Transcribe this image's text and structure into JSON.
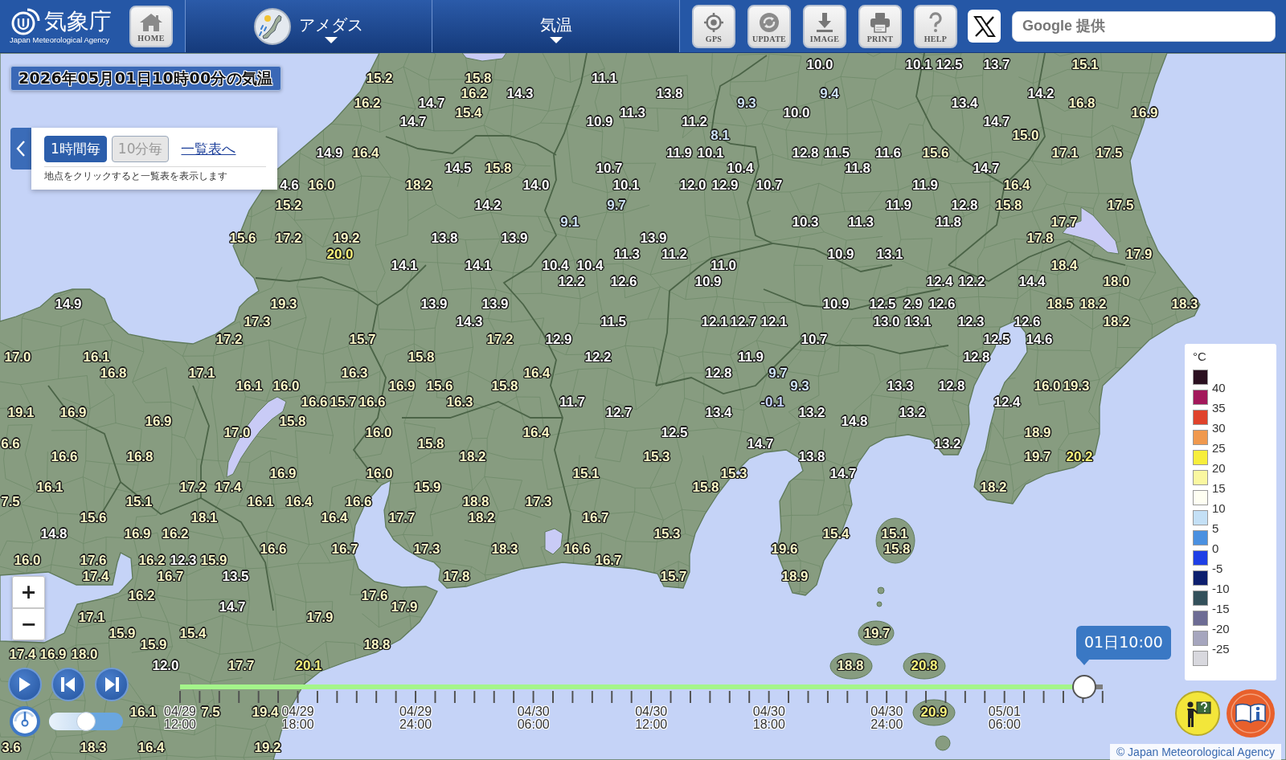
{
  "header": {
    "agency_name": "気象庁",
    "agency_subtitle": "Japan Meteorological Agency",
    "home_button": "HOME",
    "menus": [
      {
        "label": "アメダス",
        "kind": "amedas"
      },
      {
        "label": "気温",
        "kind": "element"
      }
    ],
    "tool_buttons": [
      {
        "label": "GPS",
        "kind": "locate"
      },
      {
        "label": "UPDATE",
        "kind": "refresh"
      },
      {
        "label": "IMAGE",
        "kind": "download"
      },
      {
        "label": "PRINT",
        "kind": "print"
      },
      {
        "label": "HELP",
        "kind": "help"
      }
    ],
    "search": {
      "placeholder": "Google 提供"
    }
  },
  "map_title": "2026年05月01日10時00分の気温",
  "interval_panel": {
    "options": [
      {
        "label": "1時間毎",
        "selected": true
      },
      {
        "label": "10分毎",
        "selected": false
      }
    ],
    "list_link": "一覧表へ",
    "hint": "地点をクリックすると一覧表を表示します"
  },
  "zoom_controls": [
    "+",
    "−"
  ],
  "stations": [
    {
      "value": "10.0",
      "color": "#ffffff"
    },
    {
      "value": "10.1",
      "color": "#ffffff"
    },
    {
      "value": "12.5",
      "color": "#ffffff"
    },
    {
      "value": "13.7",
      "color": "#ffffff"
    },
    {
      "value": "15.1",
      "color": "#fcf8c6"
    },
    {
      "value": "15.2",
      "color": "#fcf8c6"
    },
    {
      "value": "15.8",
      "color": "#fcf8c6"
    },
    {
      "value": "11.1",
      "color": "#ffffff"
    },
    {
      "value": "16.2",
      "color": "#fcf8c6"
    },
    {
      "value": "14.3",
      "color": "#ffffff"
    },
    {
      "value": "13.8",
      "color": "#ffffff"
    },
    {
      "value": "9.4",
      "color": "#cfe3f7"
    },
    {
      "value": "14.2",
      "color": "#ffffff"
    },
    {
      "value": "16.2",
      "color": "#fcf8c6"
    },
    {
      "value": "14.7",
      "color": "#ffffff"
    },
    {
      "value": "9.3",
      "color": "#cfe3f7"
    },
    {
      "value": "13.4",
      "color": "#ffffff"
    },
    {
      "value": "16.8",
      "color": "#fcf8c6"
    },
    {
      "value": "15.4",
      "color": "#fcf8c6"
    },
    {
      "value": "11.3",
      "color": "#ffffff"
    },
    {
      "value": "10.0",
      "color": "#ffffff"
    },
    {
      "value": "16.9",
      "color": "#fcf8c6"
    },
    {
      "value": "14.7",
      "color": "#ffffff"
    },
    {
      "value": "10.9",
      "color": "#ffffff"
    },
    {
      "value": "11.2",
      "color": "#ffffff"
    },
    {
      "value": "14.7",
      "color": "#ffffff"
    },
    {
      "value": "8.1",
      "color": "#cfe3f7"
    },
    {
      "value": "15.0",
      "color": "#fcf8c6"
    },
    {
      "value": "14.9",
      "color": "#ffffff"
    },
    {
      "value": "16.4",
      "color": "#fcf8c6"
    },
    {
      "value": "11.9",
      "color": "#ffffff"
    },
    {
      "value": "10.1",
      "color": "#ffffff"
    },
    {
      "value": "12.8",
      "color": "#ffffff"
    },
    {
      "value": "11.5",
      "color": "#ffffff"
    },
    {
      "value": "11.6",
      "color": "#ffffff"
    },
    {
      "value": "15.6",
      "color": "#fcf8c6"
    },
    {
      "value": "17.1",
      "color": "#fcf8c6"
    },
    {
      "value": "17.5",
      "color": "#fcf8c6"
    },
    {
      "value": "14.5",
      "color": "#ffffff"
    },
    {
      "value": "15.8",
      "color": "#fcf8c6"
    },
    {
      "value": "10.7",
      "color": "#ffffff"
    },
    {
      "value": "10.4",
      "color": "#ffffff"
    },
    {
      "value": "11.8",
      "color": "#ffffff"
    },
    {
      "value": "14.7",
      "color": "#ffffff"
    },
    {
      "value": "4.6",
      "color": "#ffffff"
    },
    {
      "value": "16.0",
      "color": "#fcf8c6"
    },
    {
      "value": "18.2",
      "color": "#fcf8c6"
    },
    {
      "value": "14.0",
      "color": "#ffffff"
    },
    {
      "value": "10.1",
      "color": "#ffffff"
    },
    {
      "value": "12.0",
      "color": "#ffffff"
    },
    {
      "value": "12.9",
      "color": "#ffffff"
    },
    {
      "value": "10.7",
      "color": "#ffffff"
    },
    {
      "value": "11.9",
      "color": "#ffffff"
    },
    {
      "value": "16.4",
      "color": "#fcf8c6"
    },
    {
      "value": "15.2",
      "color": "#fcf8c6"
    },
    {
      "value": "14.2",
      "color": "#ffffff"
    },
    {
      "value": "9.7",
      "color": "#cfe3f7"
    },
    {
      "value": "11.9",
      "color": "#ffffff"
    },
    {
      "value": "12.8",
      "color": "#ffffff"
    },
    {
      "value": "15.8",
      "color": "#fcf8c6"
    },
    {
      "value": "17.5",
      "color": "#fcf8c6"
    },
    {
      "value": "9.1",
      "color": "#cfe3f7"
    },
    {
      "value": "10.3",
      "color": "#ffffff"
    },
    {
      "value": "11.3",
      "color": "#ffffff"
    },
    {
      "value": "11.8",
      "color": "#ffffff"
    },
    {
      "value": "17.7",
      "color": "#fcf8c6"
    },
    {
      "value": "15.6",
      "color": "#fcf8c6"
    },
    {
      "value": "17.2",
      "color": "#fcf8c6"
    },
    {
      "value": "19.2",
      "color": "#fcf8c6"
    },
    {
      "value": "13.8",
      "color": "#ffffff"
    },
    {
      "value": "13.9",
      "color": "#ffffff"
    },
    {
      "value": "13.9",
      "color": "#ffffff"
    },
    {
      "value": "17.8",
      "color": "#fcf8c6"
    },
    {
      "value": "20.0",
      "color": "#f7f27a"
    },
    {
      "value": "11.3",
      "color": "#ffffff"
    },
    {
      "value": "11.2",
      "color": "#ffffff"
    },
    {
      "value": "10.9",
      "color": "#ffffff"
    },
    {
      "value": "13.1",
      "color": "#ffffff"
    },
    {
      "value": "17.9",
      "color": "#fcf8c6"
    },
    {
      "value": "14.1",
      "color": "#ffffff"
    },
    {
      "value": "14.1",
      "color": "#ffffff"
    },
    {
      "value": "10.4",
      "color": "#ffffff"
    },
    {
      "value": "10.4",
      "color": "#ffffff"
    },
    {
      "value": "11.0",
      "color": "#ffffff"
    },
    {
      "value": "18.4",
      "color": "#fcf8c6"
    },
    {
      "value": "12.2",
      "color": "#ffffff"
    },
    {
      "value": "12.6",
      "color": "#ffffff"
    },
    {
      "value": "10.9",
      "color": "#ffffff"
    },
    {
      "value": "12.4",
      "color": "#ffffff"
    },
    {
      "value": "12.2",
      "color": "#ffffff"
    },
    {
      "value": "14.4",
      "color": "#ffffff"
    },
    {
      "value": "18.0",
      "color": "#fcf8c6"
    },
    {
      "value": "14.9",
      "color": "#ffffff"
    },
    {
      "value": "19.3",
      "color": "#fcf8c6"
    },
    {
      "value": "13.9",
      "color": "#ffffff"
    },
    {
      "value": "13.9",
      "color": "#ffffff"
    },
    {
      "value": "10.9",
      "color": "#ffffff"
    },
    {
      "value": "12.5",
      "color": "#ffffff"
    },
    {
      "value": "2.9",
      "color": "#ffffff"
    },
    {
      "value": "12.6",
      "color": "#ffffff"
    },
    {
      "value": "18.5",
      "color": "#fcf8c6"
    },
    {
      "value": "18.2",
      "color": "#fcf8c6"
    },
    {
      "value": "18.3",
      "color": "#fcf8c6"
    },
    {
      "value": "17.3",
      "color": "#fcf8c6"
    },
    {
      "value": "14.3",
      "color": "#ffffff"
    },
    {
      "value": "11.5",
      "color": "#ffffff"
    },
    {
      "value": "12.1",
      "color": "#ffffff"
    },
    {
      "value": "12.7",
      "color": "#ffffff"
    },
    {
      "value": "12.1",
      "color": "#ffffff"
    },
    {
      "value": "13.0",
      "color": "#ffffff"
    },
    {
      "value": "13.1",
      "color": "#ffffff"
    },
    {
      "value": "12.3",
      "color": "#ffffff"
    },
    {
      "value": "12.6",
      "color": "#ffffff"
    },
    {
      "value": "18.2",
      "color": "#fcf8c6"
    },
    {
      "value": "17.2",
      "color": "#fcf8c6"
    },
    {
      "value": "15.7",
      "color": "#fcf8c6"
    },
    {
      "value": "17.2",
      "color": "#fcf8c6"
    },
    {
      "value": "12.9",
      "color": "#ffffff"
    },
    {
      "value": "10.7",
      "color": "#ffffff"
    },
    {
      "value": "12.5",
      "color": "#ffffff"
    },
    {
      "value": "14.6",
      "color": "#ffffff"
    },
    {
      "value": "17.0",
      "color": "#fcf8c6"
    },
    {
      "value": "16.1",
      "color": "#fcf8c6"
    },
    {
      "value": "15.8",
      "color": "#fcf8c6"
    },
    {
      "value": "12.2",
      "color": "#ffffff"
    },
    {
      "value": "11.9",
      "color": "#ffffff"
    },
    {
      "value": "12.8",
      "color": "#ffffff"
    },
    {
      "value": "16.8",
      "color": "#fcf8c6"
    },
    {
      "value": "17.1",
      "color": "#fcf8c6"
    },
    {
      "value": "16.3",
      "color": "#fcf8c6"
    },
    {
      "value": "16.4",
      "color": "#fcf8c6"
    },
    {
      "value": "12.8",
      "color": "#ffffff"
    },
    {
      "value": "9.7",
      "color": "#cfe3f7"
    },
    {
      "value": "16.1",
      "color": "#fcf8c6"
    },
    {
      "value": "16.0",
      "color": "#fcf8c6"
    },
    {
      "value": "16.9",
      "color": "#fcf8c6"
    },
    {
      "value": "15.6",
      "color": "#fcf8c6"
    },
    {
      "value": "15.8",
      "color": "#fcf8c6"
    },
    {
      "value": "9.3",
      "color": "#cfe3f7"
    },
    {
      "value": "13.3",
      "color": "#ffffff"
    },
    {
      "value": "12.8",
      "color": "#ffffff"
    },
    {
      "value": "16.0",
      "color": "#fcf8c6"
    },
    {
      "value": "19.3",
      "color": "#fcf8c6"
    },
    {
      "value": "16.6",
      "color": "#fcf8c6"
    },
    {
      "value": "15.7",
      "color": "#fcf8c6"
    },
    {
      "value": "16.6",
      "color": "#fcf8c6"
    },
    {
      "value": "16.3",
      "color": "#fcf8c6"
    },
    {
      "value": "11.7",
      "color": "#ffffff"
    },
    {
      "value": "-0.1",
      "color": "#c7d3ff"
    },
    {
      "value": "12.4",
      "color": "#ffffff"
    },
    {
      "value": "19.1",
      "color": "#fcf8c6"
    },
    {
      "value": "16.9",
      "color": "#fcf8c6"
    },
    {
      "value": "12.7",
      "color": "#ffffff"
    },
    {
      "value": "13.4",
      "color": "#ffffff"
    },
    {
      "value": "13.2",
      "color": "#ffffff"
    },
    {
      "value": "13.2",
      "color": "#ffffff"
    },
    {
      "value": "16.9",
      "color": "#fcf8c6"
    },
    {
      "value": "15.8",
      "color": "#fcf8c6"
    },
    {
      "value": "14.8",
      "color": "#ffffff"
    },
    {
      "value": "17.0",
      "color": "#fcf8c6"
    },
    {
      "value": "16.0",
      "color": "#fcf8c6"
    },
    {
      "value": "16.4",
      "color": "#fcf8c6"
    },
    {
      "value": "12.5",
      "color": "#ffffff"
    },
    {
      "value": "18.9",
      "color": "#fcf8c6"
    },
    {
      "value": "6.6",
      "color": "#fcf8c6"
    },
    {
      "value": "15.8",
      "color": "#fcf8c6"
    },
    {
      "value": "14.7",
      "color": "#ffffff"
    },
    {
      "value": "13.2",
      "color": "#ffffff"
    },
    {
      "value": "16.6",
      "color": "#fcf8c6"
    },
    {
      "value": "16.8",
      "color": "#fcf8c6"
    },
    {
      "value": "18.2",
      "color": "#fcf8c6"
    },
    {
      "value": "15.3",
      "color": "#fcf8c6"
    },
    {
      "value": "13.8",
      "color": "#ffffff"
    },
    {
      "value": "19.7",
      "color": "#fcf8c6"
    },
    {
      "value": "20.2",
      "color": "#f7f27a"
    },
    {
      "value": "16.9",
      "color": "#fcf8c6"
    },
    {
      "value": "16.0",
      "color": "#fcf8c6"
    },
    {
      "value": "15.1",
      "color": "#fcf8c6"
    },
    {
      "value": "15.3",
      "color": "#fcf8c6"
    },
    {
      "value": "14.7",
      "color": "#ffffff"
    },
    {
      "value": "16.1",
      "color": "#fcf8c6"
    },
    {
      "value": "17.2",
      "color": "#fcf8c6"
    },
    {
      "value": "17.4",
      "color": "#fcf8c6"
    },
    {
      "value": "15.9",
      "color": "#fcf8c6"
    },
    {
      "value": "15.8",
      "color": "#fcf8c6"
    },
    {
      "value": "18.2",
      "color": "#fcf8c6"
    },
    {
      "value": "7.5",
      "color": "#fcf8c6"
    },
    {
      "value": "15.1",
      "color": "#fcf8c6"
    },
    {
      "value": "16.1",
      "color": "#fcf8c6"
    },
    {
      "value": "16.4",
      "color": "#fcf8c6"
    },
    {
      "value": "16.6",
      "color": "#fcf8c6"
    },
    {
      "value": "18.8",
      "color": "#fcf8c6"
    },
    {
      "value": "17.3",
      "color": "#fcf8c6"
    },
    {
      "value": "15.6",
      "color": "#fcf8c6"
    },
    {
      "value": "18.1",
      "color": "#fcf8c6"
    },
    {
      "value": "16.4",
      "color": "#fcf8c6"
    },
    {
      "value": "17.7",
      "color": "#fcf8c6"
    },
    {
      "value": "18.2",
      "color": "#fcf8c6"
    },
    {
      "value": "16.7",
      "color": "#fcf8c6"
    },
    {
      "value": "14.8",
      "color": "#ffffff"
    },
    {
      "value": "16.9",
      "color": "#fcf8c6"
    },
    {
      "value": "16.2",
      "color": "#fcf8c6"
    },
    {
      "value": "15.3",
      "color": "#fcf8c6"
    },
    {
      "value": "15.4",
      "color": "#fcf8c6"
    },
    {
      "value": "15.1",
      "color": "#fcf8c6"
    },
    {
      "value": "16.6",
      "color": "#fcf8c6"
    },
    {
      "value": "16.7",
      "color": "#fcf8c6"
    },
    {
      "value": "17.3",
      "color": "#fcf8c6"
    },
    {
      "value": "18.3",
      "color": "#fcf8c6"
    },
    {
      "value": "16.6",
      "color": "#fcf8c6"
    },
    {
      "value": "19.6",
      "color": "#fcf8c6"
    },
    {
      "value": "15.8",
      "color": "#fcf8c6"
    },
    {
      "value": "16.0",
      "color": "#fcf8c6"
    },
    {
      "value": "17.6",
      "color": "#fcf8c6"
    },
    {
      "value": "16.2",
      "color": "#fcf8c6"
    },
    {
      "value": "12.3",
      "color": "#ffffff"
    },
    {
      "value": "15.9",
      "color": "#fcf8c6"
    },
    {
      "value": "16.7",
      "color": "#fcf8c6"
    },
    {
      "value": "17.4",
      "color": "#fcf8c6"
    },
    {
      "value": "16.7",
      "color": "#fcf8c6"
    },
    {
      "value": "13.5",
      "color": "#ffffff"
    },
    {
      "value": "17.8",
      "color": "#fcf8c6"
    },
    {
      "value": "15.7",
      "color": "#fcf8c6"
    },
    {
      "value": "18.9",
      "color": "#fcf8c6"
    },
    {
      "value": "16.2",
      "color": "#fcf8c6"
    },
    {
      "value": "17.6",
      "color": "#fcf8c6"
    },
    {
      "value": "14.7",
      "color": "#ffffff"
    },
    {
      "value": "17.9",
      "color": "#fcf8c6"
    },
    {
      "value": "17.1",
      "color": "#fcf8c6"
    },
    {
      "value": "17.9",
      "color": "#fcf8c6"
    },
    {
      "value": "15.9",
      "color": "#fcf8c6"
    },
    {
      "value": "15.4",
      "color": "#fcf8c6"
    },
    {
      "value": "19.7",
      "color": "#fcf8c6"
    },
    {
      "value": "15.9",
      "color": "#fcf8c6"
    },
    {
      "value": "18.8",
      "color": "#fcf8c6"
    },
    {
      "value": "17.4",
      "color": "#fcf8c6"
    },
    {
      "value": "16.9",
      "color": "#fcf8c6"
    },
    {
      "value": "18.0",
      "color": "#fcf8c6"
    },
    {
      "value": "12.0",
      "color": "#ffffff"
    },
    {
      "value": "17.7",
      "color": "#fcf8c6"
    },
    {
      "value": "20.1",
      "color": "#f7f27a"
    },
    {
      "value": "18.8",
      "color": "#fcf8c6"
    },
    {
      "value": "20.8",
      "color": "#f7f27a"
    },
    {
      "value": "16.1",
      "color": "#fcf8c6"
    },
    {
      "value": "7.5",
      "color": "#fcf8c6"
    },
    {
      "value": "19.4",
      "color": "#fcf8c6"
    },
    {
      "value": "20.9",
      "color": "#f7f27a"
    },
    {
      "value": "3.6",
      "color": "#fcf8c6"
    },
    {
      "value": "18.3",
      "color": "#fcf8c6"
    },
    {
      "value": "16.4",
      "color": "#fcf8c6"
    },
    {
      "value": "19.2",
      "color": "#fcf8c6"
    }
  ],
  "playback": {
    "speed_slider": {
      "level": 0.5
    }
  },
  "timeline": {
    "level": 0.98,
    "current_time": "01日10:00",
    "labels": [
      {
        "date": "04/29",
        "time": "12:00"
      },
      {
        "date": "04/29",
        "time": "18:00"
      },
      {
        "date": "04/29",
        "time": "24:00"
      },
      {
        "date": "04/30",
        "time": "06:00"
      },
      {
        "date": "04/30",
        "time": "12:00"
      },
      {
        "date": "04/30",
        "time": "18:00"
      },
      {
        "date": "04/30",
        "time": "24:00"
      },
      {
        "date": "05/01",
        "time": "06:00"
      }
    ]
  },
  "legend": {
    "unit": "°C",
    "swatches": [
      {
        "color": "#2b1020"
      },
      {
        "color": "#a3195b"
      },
      {
        "color": "#e0432c"
      },
      {
        "color": "#f0994e"
      },
      {
        "color": "#f7ee3c"
      },
      {
        "color": "#faf7a0"
      },
      {
        "color": "#fefef2"
      },
      {
        "color": "#c4e0f6"
      },
      {
        "color": "#4a90e0"
      },
      {
        "color": "#1e3fe6"
      },
      {
        "color": "#0d1f6e"
      },
      {
        "color": "#33505a"
      },
      {
        "color": "#6d6c94"
      },
      {
        "color": "#a6a6be"
      },
      {
        "color": "#d8d8de"
      }
    ],
    "labels": [
      "40",
      "35",
      "30",
      "25",
      "20",
      "15",
      "10",
      "5",
      "0",
      "-5",
      "-10",
      "-15",
      "-20",
      "-25"
    ]
  },
  "copyright": "© Japan Meteorological Agency"
}
